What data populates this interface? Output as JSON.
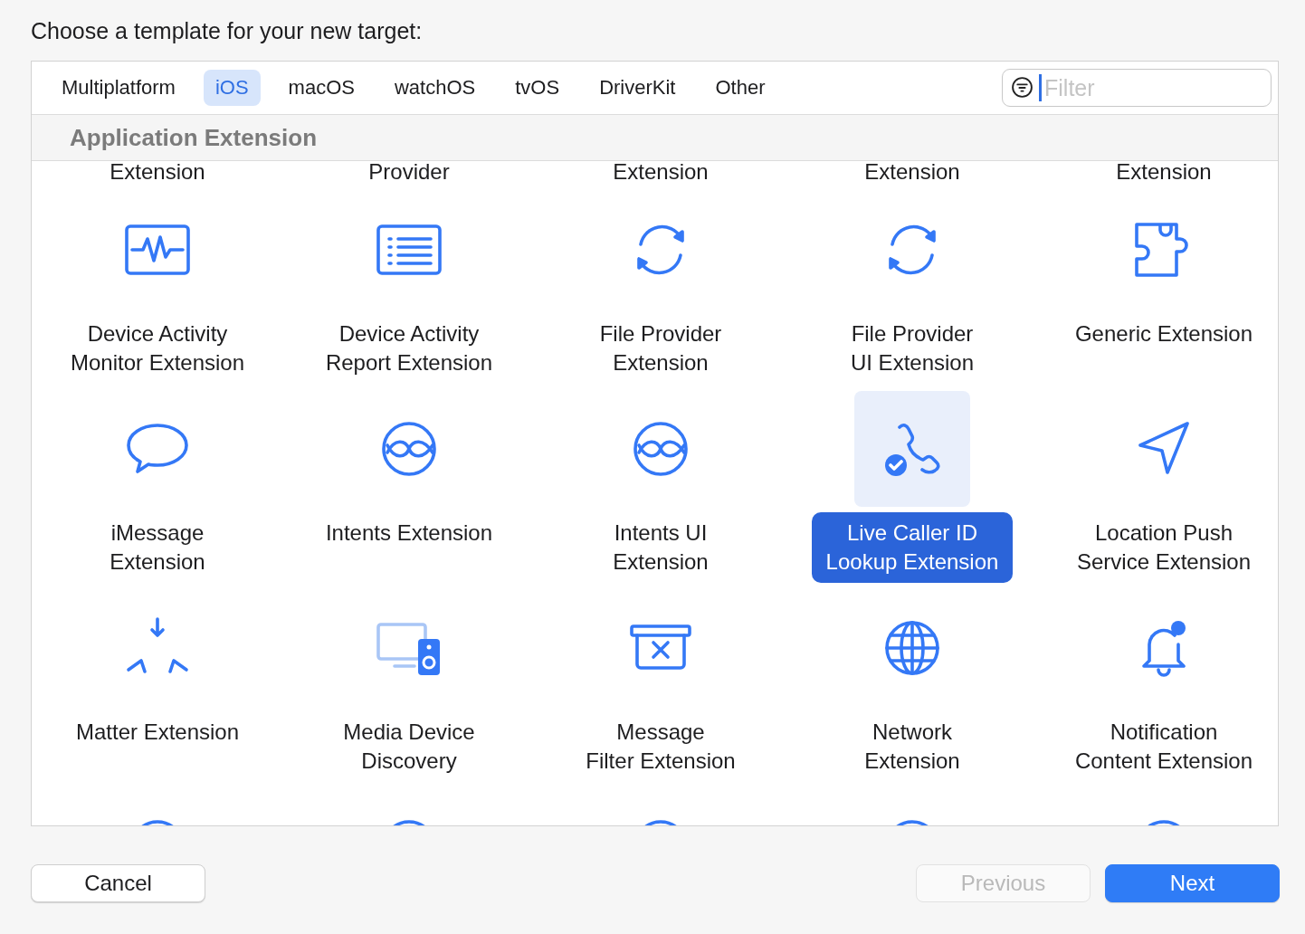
{
  "heading": "Choose a template for your new target:",
  "tabs": [
    {
      "label": "Multiplatform",
      "selected": false
    },
    {
      "label": "iOS",
      "selected": true
    },
    {
      "label": "macOS",
      "selected": false
    },
    {
      "label": "watchOS",
      "selected": false
    },
    {
      "label": "tvOS",
      "selected": false
    },
    {
      "label": "DriverKit",
      "selected": false
    },
    {
      "label": "Other",
      "selected": false
    }
  ],
  "filter": {
    "placeholder": "Filter"
  },
  "section": {
    "title": "Application Extension"
  },
  "cut_labels": [
    "Extension",
    "Provider",
    "Extension",
    "Extension",
    "Extension"
  ],
  "templates": [
    {
      "label": "Device Activity\nMonitor Extension",
      "kind": "monitor",
      "selected": false
    },
    {
      "label": "Device Activity\nReport Extension",
      "kind": "list",
      "selected": false
    },
    {
      "label": "File Provider\nExtension",
      "kind": "sync",
      "selected": false
    },
    {
      "label": "File Provider\nUI Extension",
      "kind": "sync",
      "selected": false
    },
    {
      "label": "Generic Extension",
      "kind": "puzzle",
      "selected": false
    },
    {
      "label": "iMessage\nExtension",
      "kind": "bubble",
      "selected": false
    },
    {
      "label": "Intents Extension",
      "kind": "intents",
      "selected": false
    },
    {
      "label": "Intents UI\nExtension",
      "kind": "intents",
      "selected": false
    },
    {
      "label": "Live Caller ID\nLookup Extension",
      "kind": "phone",
      "selected": true
    },
    {
      "label": "Location Push\nService Extension",
      "kind": "location",
      "selected": false
    },
    {
      "label": "Matter Extension",
      "kind": "matter",
      "selected": false
    },
    {
      "label": "Media Device\nDiscovery",
      "kind": "media",
      "selected": false
    },
    {
      "label": "Message\nFilter Extension",
      "kind": "trash",
      "selected": false
    },
    {
      "label": "Network\nExtension",
      "kind": "globe",
      "selected": false
    },
    {
      "label": "Notification\nContent Extension",
      "kind": "bell",
      "selected": false
    }
  ],
  "buttons": [
    {
      "label": "Cancel",
      "disabled": false,
      "default": false
    },
    {
      "label": "Previous",
      "disabled": true,
      "default": false
    },
    {
      "label": "Next",
      "disabled": false,
      "default": true
    }
  ]
}
